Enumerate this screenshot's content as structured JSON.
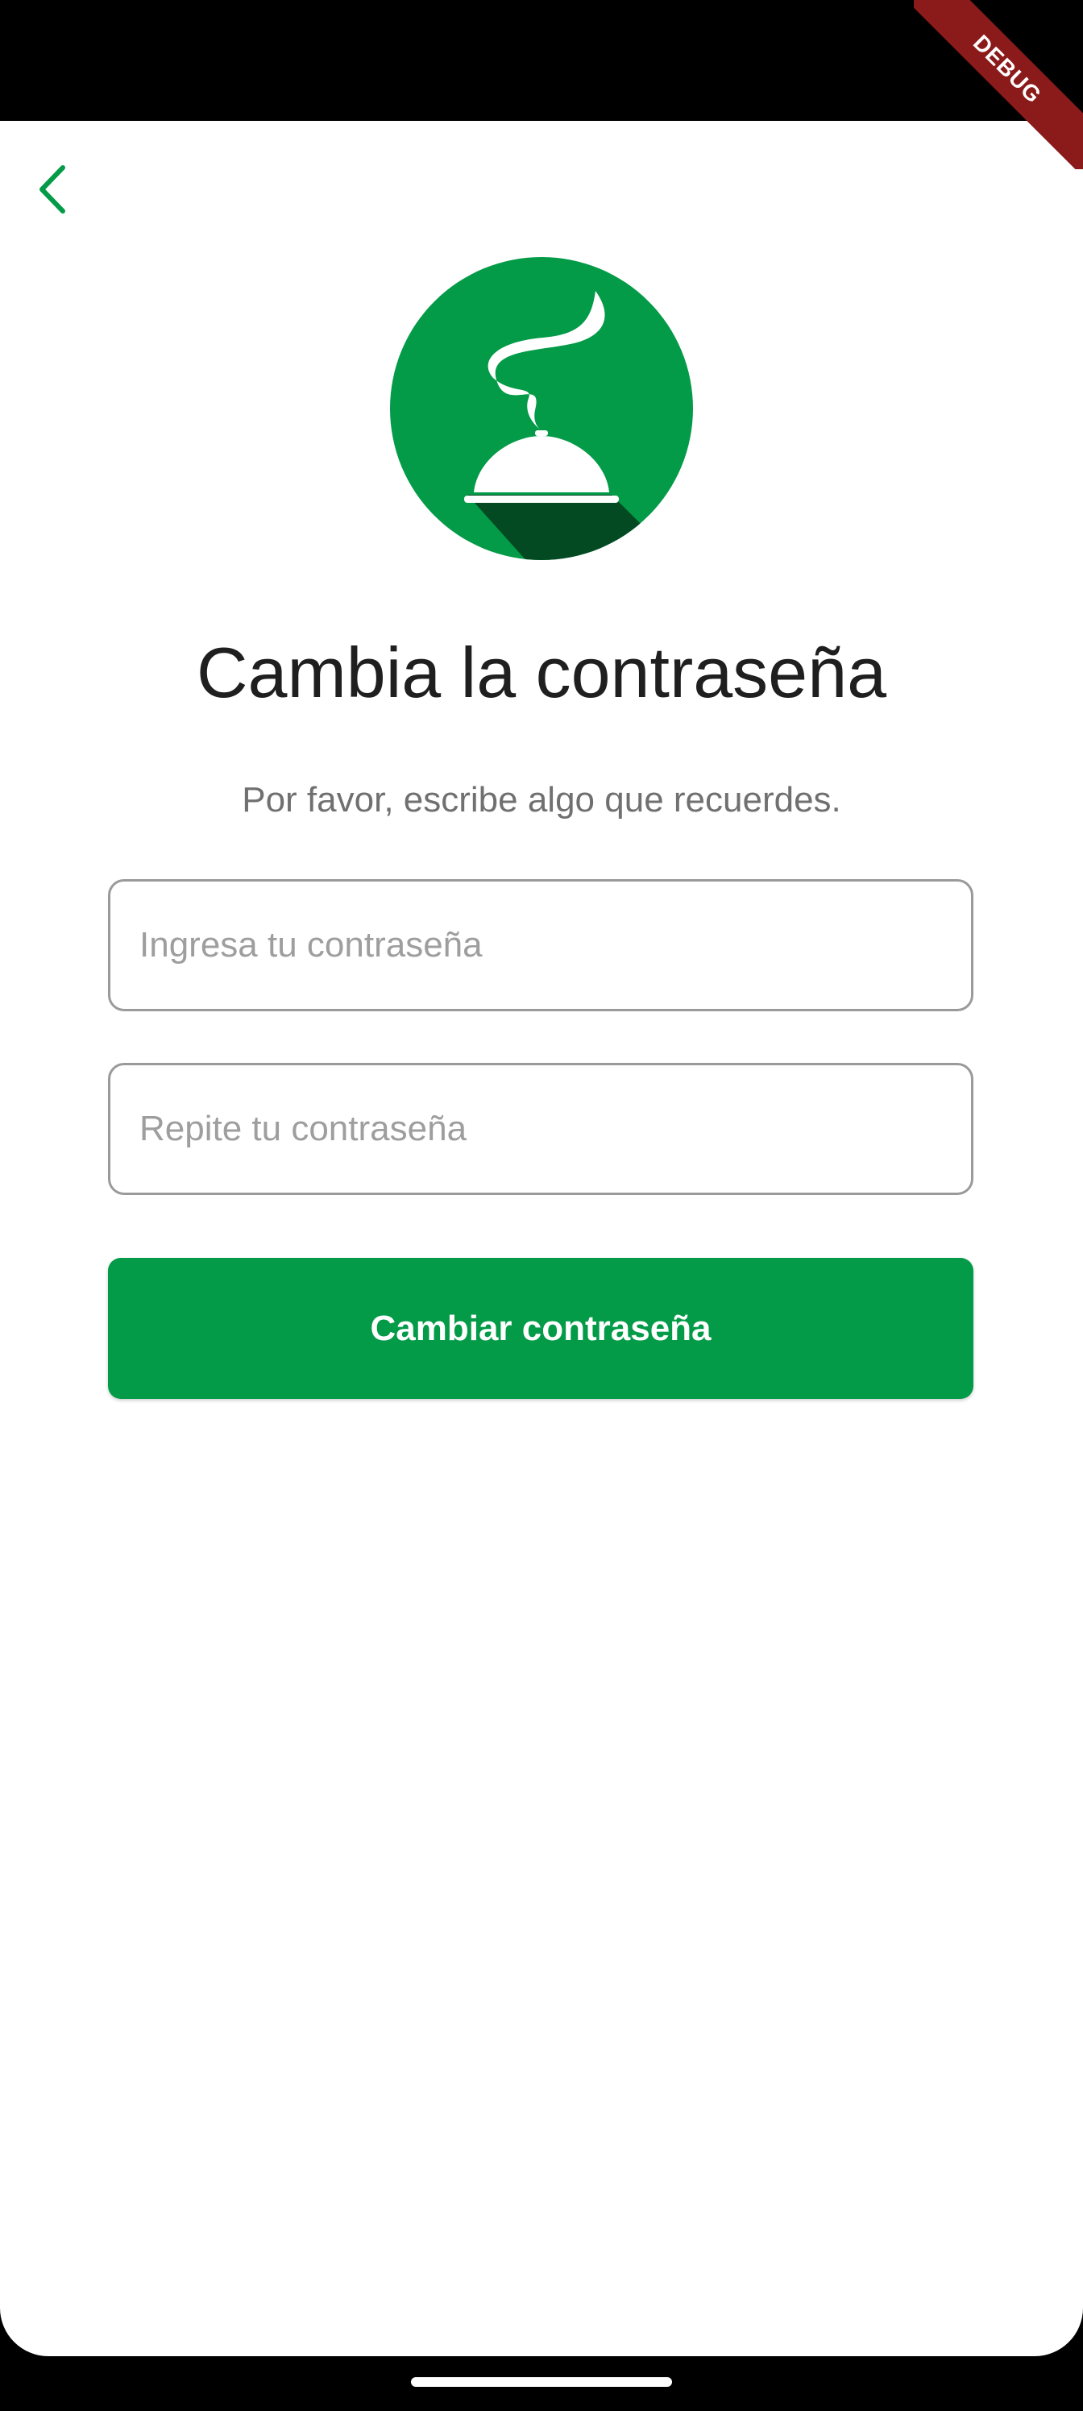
{
  "debug_banner": "DEBUG",
  "header": {
    "back_icon": "chevron-left-icon"
  },
  "logo": {
    "icon": "serving-cloche-icon",
    "background_color": "#039b47",
    "shadow_color": "#034a22"
  },
  "title": "Cambia la contraseña",
  "subtitle": "Por favor, escribe algo que recuerdes.",
  "form": {
    "password": {
      "value": "",
      "placeholder": "Ingresa tu contraseña"
    },
    "confirm_password": {
      "value": "",
      "placeholder": "Repite tu contraseña"
    },
    "submit_label": "Cambiar contraseña"
  },
  "colors": {
    "accent": "#039b47",
    "debug_banner": "#8b1a1a",
    "title_text": "#1f1f1f",
    "subtitle_text": "#707070"
  }
}
